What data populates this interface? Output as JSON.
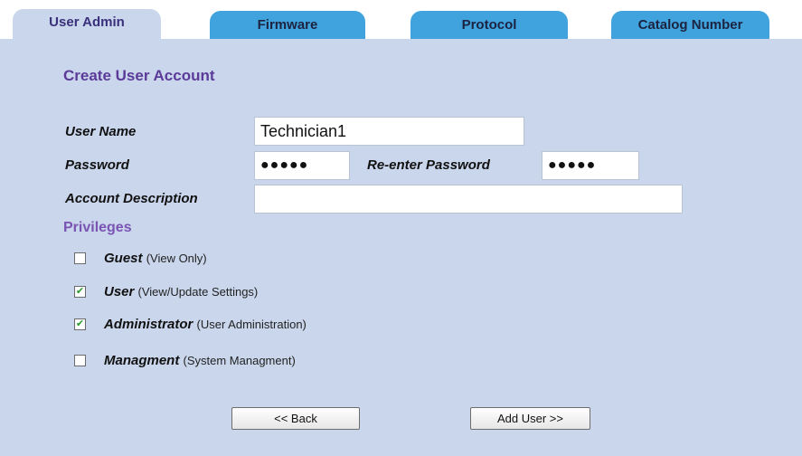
{
  "tabs": [
    {
      "label": "User Admin",
      "active": true
    },
    {
      "label": "Firmware",
      "active": false
    },
    {
      "label": "Protocol",
      "active": false
    },
    {
      "label": "Catalog Number",
      "active": false
    }
  ],
  "form": {
    "title": "Create User Account",
    "user_name_label": "User Name",
    "user_name_value": "Technician1",
    "password_label": "Password",
    "password_value": "●●●●●",
    "reenter_password_label": "Re-enter Password",
    "reenter_password_value": "●●●●●",
    "account_description_label": "Account Description",
    "account_description_value": ""
  },
  "privileges": {
    "title": "Privileges",
    "items": [
      {
        "name": "Guest",
        "desc": "(View Only)",
        "checked": false
      },
      {
        "name": "User",
        "desc": "(View/Update Settings)",
        "checked": true
      },
      {
        "name": "Administrator",
        "desc": "(User Administration)",
        "checked": true
      },
      {
        "name": "Managment",
        "desc": "(System Managment)",
        "checked": false
      }
    ]
  },
  "buttons": {
    "back": "<< Back",
    "add_user": "Add User >>"
  },
  "colors": {
    "panel": "#c9d6ec",
    "inactive_tab": "#41a3dd",
    "title": "#5b3a99"
  }
}
